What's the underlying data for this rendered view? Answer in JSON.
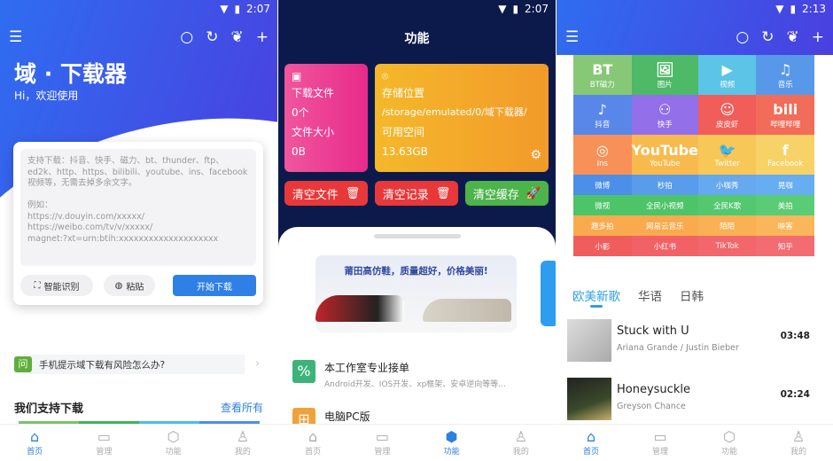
{
  "status": {
    "p1_time": "2:07",
    "p2_time": "2:07",
    "p3_time": "2:13"
  },
  "home": {
    "title": "域 · 下载器",
    "subtitle": "Hi，欢迎使用",
    "input_placeholder": "支持下载：抖音、快手、磁力、bt、thunder、ftp、ed2k、http、https、bilibili、youtube、ins、facebook视频等，无需去掉多余文字。\n\n例如：\nhttps://v.douyin.com/xxxxx/\nhttps://weibo.com/tv/v/xxxxx/\nmagnet:?xt=urn:btih:xxxxxxxxxxxxxxxxxxxx",
    "smart_btn": "智能识别",
    "paste_btn": "粘贴",
    "start_btn": "开始下载",
    "faq_badge": "问",
    "faq_text": "手机提示域下载有风险怎么办?",
    "support_title": "我们支持下载",
    "see_all": "查看所有"
  },
  "func": {
    "title": "功能",
    "dl_files_label": "下载文件",
    "dl_files_value": "0个",
    "file_size_label": "文件大小",
    "file_size_value": "0B",
    "storage_label": "存储位置",
    "storage_path": "/storage/emulated/0/域下载器/",
    "free_label": "可用空间",
    "free_value": "13.63GB",
    "clear_files": "清空文件",
    "clear_records": "清空记录",
    "clear_cache": "清空缓存",
    "banner_text": "莆田高仿鞋，质量超好，价格美丽!",
    "list": [
      {
        "title": "本工作室专业接单",
        "desc": "Android开发、IOS开发、xp框架、安卓逆向等等..."
      },
      {
        "title": "电脑PC版",
        "desc": ""
      }
    ]
  },
  "grid": {
    "big": [
      {
        "icon": "BT",
        "label": "BT磁力",
        "color": "#7cc46a"
      },
      {
        "icon": "🖼",
        "label": "图片",
        "color": "#3fb45a"
      },
      {
        "icon": "▶",
        "label": "视频",
        "color": "#4fbfe6"
      },
      {
        "icon": "♫",
        "label": "音乐",
        "color": "#4a90e8"
      },
      {
        "icon": "♪",
        "label": "抖音",
        "color": "#4b7de8"
      },
      {
        "icon": "⚇",
        "label": "快手",
        "color": "#8a63e8"
      },
      {
        "icon": "☺",
        "label": "皮皮虾",
        "color": "#f0504c"
      },
      {
        "icon": "bili",
        "label": "哔哩哔哩",
        "color": "#f0604c"
      },
      {
        "icon": "◎",
        "label": "Ins",
        "color": "#f7884a"
      },
      {
        "icon": "YouTube",
        "label": "YouTube",
        "color": "#f9b53e"
      },
      {
        "icon": "🐦",
        "label": "Twitter",
        "color": "#f7c34a"
      },
      {
        "icon": "f",
        "label": "Facebook",
        "color": "#f7cf5a"
      }
    ],
    "small": [
      {
        "label": "微博",
        "color": "#3d86e8"
      },
      {
        "label": "秒拍",
        "color": "#4a94ea"
      },
      {
        "label": "小咖秀",
        "color": "#5aa2ee"
      },
      {
        "label": "晃咖",
        "color": "#5aa7f0"
      },
      {
        "label": "微视",
        "color": "#3fbf5c"
      },
      {
        "label": "全民小视频",
        "color": "#3fbf5c"
      },
      {
        "label": "全民K歌",
        "color": "#45c463"
      },
      {
        "label": "美拍",
        "color": "#4dc86a"
      },
      {
        "label": "趣多拍",
        "color": "#f9a33e"
      },
      {
        "label": "网易云音乐",
        "color": "#f9a33e"
      },
      {
        "label": "陌陌",
        "color": "#f9ab45"
      },
      {
        "label": "映客",
        "color": "#f9b04d"
      },
      {
        "label": "小影",
        "color": "#f0504f"
      },
      {
        "label": "小红书",
        "color": "#f0545a"
      },
      {
        "label": "TikTok",
        "color": "#f15a60"
      },
      {
        "label": "知乎",
        "color": "#f26066"
      }
    ]
  },
  "music": {
    "tabs": [
      "欧美新歌",
      "华语",
      "日韩"
    ],
    "songs": [
      {
        "title": "Stuck with U",
        "artist": "Ariana Grande / Justin Bieber",
        "duration": "03:48"
      },
      {
        "title": "Honeysuckle",
        "artist": "Greyson Chance",
        "duration": "02:24"
      }
    ]
  },
  "nav": [
    "首页",
    "管理",
    "功能",
    "我的"
  ],
  "accent": "#2e7fe0"
}
